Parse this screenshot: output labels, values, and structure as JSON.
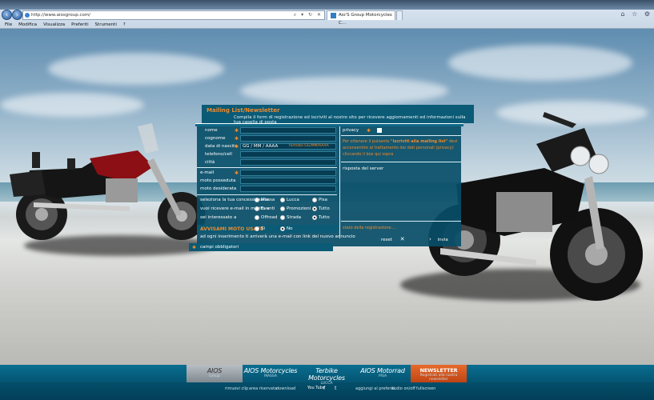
{
  "browser": {
    "url": "http://www.aiosgroup.com/",
    "tab_title": "Aio'S Group Motorcycles C...",
    "menu": [
      "File",
      "Modifica",
      "Visualizza",
      "Preferiti",
      "Strumenti",
      "?"
    ]
  },
  "form": {
    "title": "Mailing List/Newsletter",
    "subtitle": "Compila il form di registrazione ed iscriviti al nostro sito per ricevere aggiornamenti ed informazioni sulla tua casella di posta",
    "fields": {
      "nome": "nome",
      "cognome": "cognome",
      "data_nascita": "data di nascita",
      "data_value": "GG / MM / AAAA",
      "data_hint": "formato GG/MM/AAAA",
      "telefono": "telefono/cell",
      "citta": "città",
      "email": "e-mail",
      "moto_posseduta": "moto posseduta",
      "moto_desiderata": "moto desiderata"
    },
    "privacy_label": "privacy",
    "privacy_text_1": "Per ottenere il pulsante",
    "privacy_text_bold": "\"iscriviti alla mailing list\"",
    "privacy_text_2": "devi",
    "privacy_text_3": "acconsentire al trattamento dei dati personali (privacy)",
    "privacy_text_4": "cliccando il box qui sopra",
    "server_response": "risposta del server",
    "concessionaria_label": "seleziona la tua concessionaria",
    "concessionaria_options": [
      "Massa",
      "Lucca",
      "Pisa"
    ],
    "email_label": "vuoi ricevere e-mail in merito a",
    "email_options": [
      "Eventi",
      "Promozioni",
      "Tutto"
    ],
    "interesse_label": "sei interessato a",
    "interesse_options": [
      "Offroad",
      "Strada",
      "Tutto"
    ],
    "usate_title": "AVVISAMI MOTO USATE",
    "usate_yes": "Sì",
    "usate_no": "No",
    "usate_desc": "ad ogni inserimento ti arriverà una e-mail con link del nuovo annuncio",
    "status": "stato della registrazione....",
    "required": "campi obbligatori",
    "reset": "reset",
    "invia": "invia"
  },
  "bottom": {
    "brands": [
      {
        "name": "AIOS",
        "sub": "Group"
      },
      {
        "name": "AIOS Motorcycles",
        "sub": "MASSA"
      },
      {
        "name": "Terbike Motorcycles",
        "sub": "LUCCA"
      },
      {
        "name": "AIOS Motorrad",
        "sub": "PISA"
      },
      {
        "name": "NEWSLETTER",
        "sub": "Registrati alla nostra newsletter"
      }
    ],
    "links": [
      "rimuovi clip",
      "area riservata",
      "download",
      "aggiungi ai preferiti",
      "audio on/off",
      "fullscreen"
    ],
    "youtube": "You Tube"
  }
}
